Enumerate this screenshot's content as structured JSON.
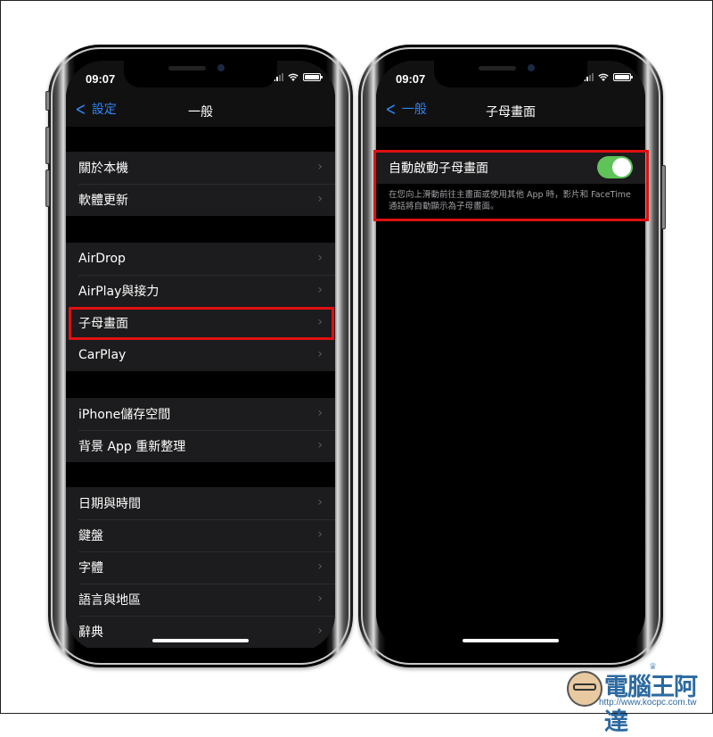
{
  "status_bar": {
    "time": "09:07"
  },
  "left_phone": {
    "nav": {
      "back_label": "設定",
      "title": "一般"
    },
    "groups": [
      {
        "items": [
          {
            "label": "關於本機"
          },
          {
            "label": "軟體更新"
          }
        ]
      },
      {
        "items": [
          {
            "label": "AirDrop"
          },
          {
            "label": "AirPlay與接力"
          },
          {
            "label": "子母畫面",
            "highlighted": true
          },
          {
            "label": "CarPlay"
          }
        ]
      },
      {
        "items": [
          {
            "label": "iPhone儲存空間"
          },
          {
            "label": "背景 App 重新整理"
          }
        ]
      },
      {
        "items": [
          {
            "label": "日期與時間"
          },
          {
            "label": "鍵盤"
          },
          {
            "label": "字體"
          },
          {
            "label": "語言與地區"
          },
          {
            "label": "辭典"
          }
        ]
      }
    ],
    "chevron": "›"
  },
  "right_phone": {
    "nav": {
      "back_label": "一般",
      "title": "子母畫面"
    },
    "setting": {
      "label": "自動啟動子母畫面",
      "toggle_on": true
    },
    "footnote": "在您向上滑動前往主畫面或使用其他 App 時，影片和 FaceTime通話將自動顯示為子母畫面。"
  },
  "colors": {
    "accent": "#2f84f5",
    "toggle_on": "#5fc35a",
    "highlight": "#e01010",
    "cell_bg": "#1c1c1e"
  },
  "watermark": {
    "title": "電腦王阿達",
    "url": "http://www.kocpc.com.tw"
  }
}
